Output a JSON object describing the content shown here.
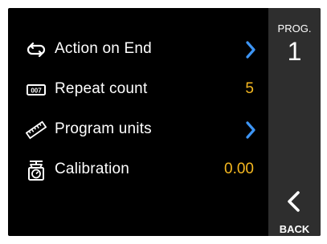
{
  "menu": {
    "items": [
      {
        "label": "Action on End",
        "icon": "repeat-loop-icon",
        "control": "chevron-right-icon"
      },
      {
        "label": "Repeat count",
        "icon": "counter-icon",
        "value": "5"
      },
      {
        "label": "Program units",
        "icon": "ruler-icon",
        "control": "chevron-right-icon"
      },
      {
        "label": "Calibration",
        "icon": "scale-icon",
        "value": "0.00"
      }
    ]
  },
  "sidebar": {
    "prog_label": "PROG.",
    "prog_number": "1",
    "back_label": "BACK",
    "back_icon": "chevron-left-icon"
  },
  "colors": {
    "background": "#000000",
    "sidebar": "#2e2e2e",
    "text": "#ffffff",
    "value": "#f6b820",
    "chevron": "#3d95f5"
  }
}
